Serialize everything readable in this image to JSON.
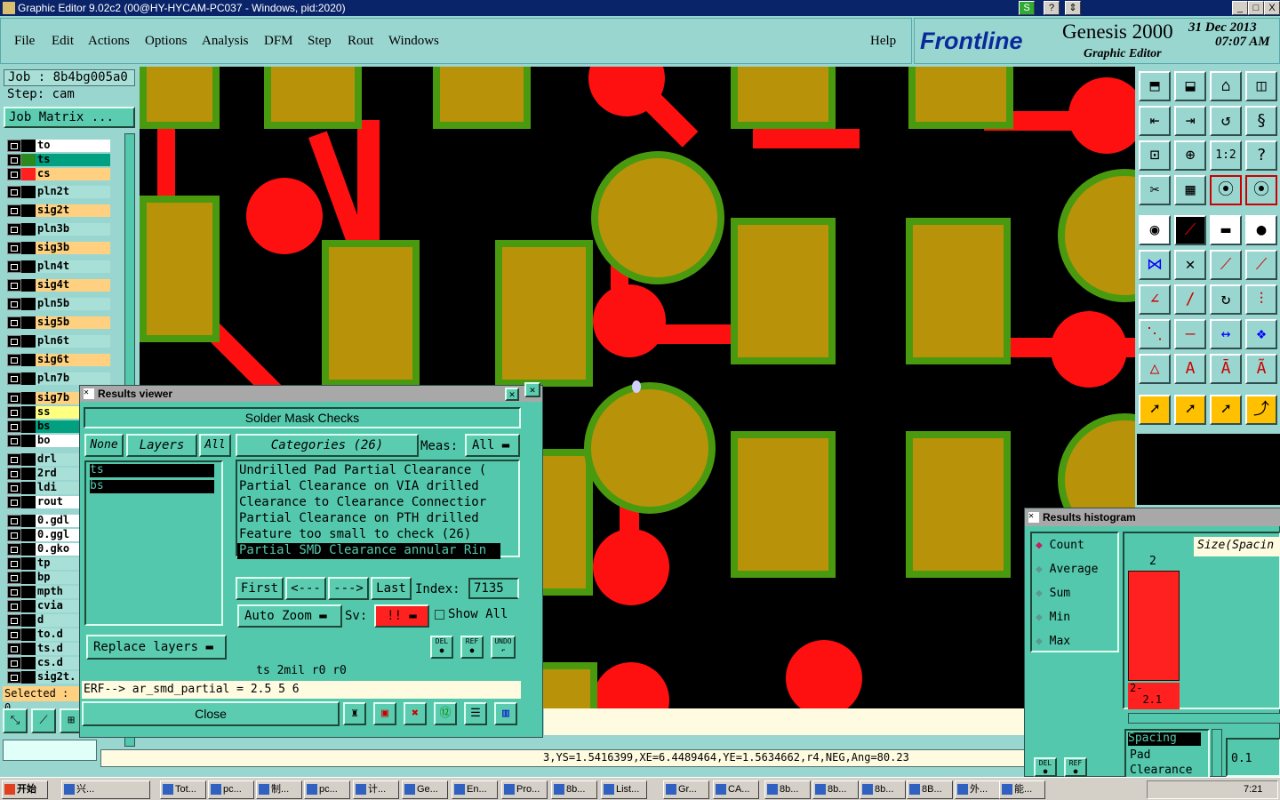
{
  "titlebar": {
    "title": "Graphic Editor 9.02c2 (00@HY-HYCAM-PC037 - Windows, pid:2020)",
    "min": "_",
    "max": "□",
    "close": "X",
    "icon_s": "S",
    "icon_help": "?",
    "icon_arrow": "⇕"
  },
  "menu": {
    "file": "File",
    "edit": "Edit",
    "actions": "Actions",
    "options": "Options",
    "analysis": "Analysis",
    "dfm": "DFM",
    "step": "Step",
    "rout": "Rout",
    "windows": "Windows",
    "help": "Help"
  },
  "brand": {
    "logo": "Frontline",
    "product": "Genesis 2000",
    "subtitle": "Graphic Editor",
    "date": "31 Dec 2013",
    "time": "07:07 AM"
  },
  "job": {
    "job": "Job : 8b4bg005a0",
    "step": "Step: cam",
    "matrix": "Job Matrix ..."
  },
  "layers": [
    {
      "name": "to",
      "color": "#ffffff",
      "col": "#000000"
    },
    {
      "name": "ts",
      "color": "#00a080",
      "col": "#2a8a20"
    },
    {
      "name": "cs",
      "color": "#ffd080",
      "col": "#ff2020"
    },
    {
      "name": "pln2t",
      "color": "#a8e0d8",
      "col": "#000000"
    },
    {
      "name": "sig2t",
      "color": "#ffd080",
      "col": "#000000"
    },
    {
      "name": "pln3b",
      "color": "#a8e0d8",
      "col": "#000000"
    },
    {
      "name": "sig3b",
      "color": "#ffd080",
      "col": "#000000"
    },
    {
      "name": "pln4t",
      "color": "#a8e0d8",
      "col": "#000000"
    },
    {
      "name": "sig4t",
      "color": "#ffd080",
      "col": "#000000"
    },
    {
      "name": "pln5b",
      "color": "#a8e0d8",
      "col": "#000000"
    },
    {
      "name": "sig5b",
      "color": "#ffd080",
      "col": "#000000"
    },
    {
      "name": "pln6t",
      "color": "#a8e0d8",
      "col": "#000000"
    },
    {
      "name": "sig6t",
      "color": "#ffd080",
      "col": "#000000"
    },
    {
      "name": "pln7b",
      "color": "#a8e0d8",
      "col": "#000000"
    },
    {
      "name": "sig7b",
      "color": "#ffd080",
      "col": "#000000"
    },
    {
      "name": "ss",
      "color": "#ffff80",
      "col": "#000000"
    },
    {
      "name": "bs",
      "color": "#00a080",
      "col": "#000000"
    },
    {
      "name": "bo",
      "color": "#ffffff",
      "col": "#000000"
    },
    {
      "name": "drl",
      "color": "#a8e0d8",
      "col": "#000000"
    },
    {
      "name": "2rd",
      "color": "#a8e0d8",
      "col": "#000000"
    },
    {
      "name": "ldi",
      "color": "#a8e0d8",
      "col": "#000000"
    },
    {
      "name": "rout",
      "color": "#ffffff",
      "col": "#000000"
    },
    {
      "name": "0.gdl",
      "color": "#ffffff",
      "col": "#000000"
    },
    {
      "name": "0.ggl",
      "color": "#ffffff",
      "col": "#000000"
    },
    {
      "name": "0.gko",
      "color": "#ffffff",
      "col": "#000000"
    },
    {
      "name": "tp",
      "color": "#a8e0d8",
      "col": "#000000"
    },
    {
      "name": "bp",
      "color": "#a8e0d8",
      "col": "#000000"
    },
    {
      "name": "mpth",
      "color": "#a8e0d8",
      "col": "#000000"
    },
    {
      "name": "cvia",
      "color": "#a8e0d8",
      "col": "#000000"
    },
    {
      "name": "d",
      "color": "#a8e0d8",
      "col": "#000000"
    },
    {
      "name": "to.d",
      "color": "#a8e0d8",
      "col": "#000000"
    },
    {
      "name": "ts.d",
      "color": "#a8e0d8",
      "col": "#000000"
    },
    {
      "name": "cs.d",
      "color": "#a8e0d8",
      "col": "#000000"
    },
    {
      "name": "sig2t.",
      "color": "#a8e0d8",
      "col": "#000000"
    }
  ],
  "selected": "Selected : 0",
  "results_viewer": {
    "title": "Results viewer",
    "header": "Solder Mask Checks",
    "none": "None",
    "layers": "Layers",
    "all": "All",
    "layer_list": [
      "ts",
      "bs"
    ],
    "categories": "Categories (26)",
    "meas_label": "Meas:",
    "meas_value": "All",
    "category_items": [
      "Undrilled Pad Partial Clearance (",
      "Partial Clearance on VIA drilled",
      "Clearance to Clearance Connectior",
      "Partial Clearance on PTH drilled",
      "Feature too small to check (26)",
      "Partial SMD Clearance annular Rin"
    ],
    "first": "First",
    "prev": "<---",
    "next": "--->",
    "last": "Last",
    "index_label": "Index:",
    "index_value": "7135",
    "auto_zoom": "Auto Zoom",
    "sv_label": "Sv:",
    "sv_value": "!!",
    "show_all": "Show All",
    "replace_layers": "Replace layers",
    "del": "DEL",
    "ref": "REF",
    "undo": "UNDO",
    "status1": "ts 2mil  r0  r0",
    "status2": "ERF--> ar_smd_partial = 2.5 5 6",
    "close": "Close"
  },
  "histogram": {
    "title": "Results histogram",
    "options": [
      "Count",
      "Average",
      "Sum",
      "Min",
      "Max"
    ],
    "size_label": "Size(Spacin",
    "bar_count": "2",
    "bar_range": "2-\n  2.1",
    "list": [
      "Spacing",
      "Pad",
      "Clearance"
    ],
    "scale": "0.1",
    "del": "DEL",
    "ref": "REF"
  },
  "coords": "3,YS=1.5416399,XE=6.4489464,YE=1.5634662,r4,NEG,Ang=80.23",
  "taskbar": {
    "start": "开始",
    "items": [
      "兴...",
      "Tot...",
      "pc...",
      "制...",
      "pc...",
      "计...",
      "Ge...",
      "En...",
      "Pro...",
      "8b...",
      "List...",
      "Gr...",
      "CA...",
      "8b...",
      "8b...",
      "8b...",
      "8B...",
      "外...",
      "能..."
    ],
    "clock": "7:21"
  },
  "colors": {
    "bg": "#9ad6d0",
    "panel": "#54c8ac",
    "pad": "#b8930a",
    "mask": "#4a9a10",
    "copper": "#ff1010",
    "canvas": "#000000"
  }
}
